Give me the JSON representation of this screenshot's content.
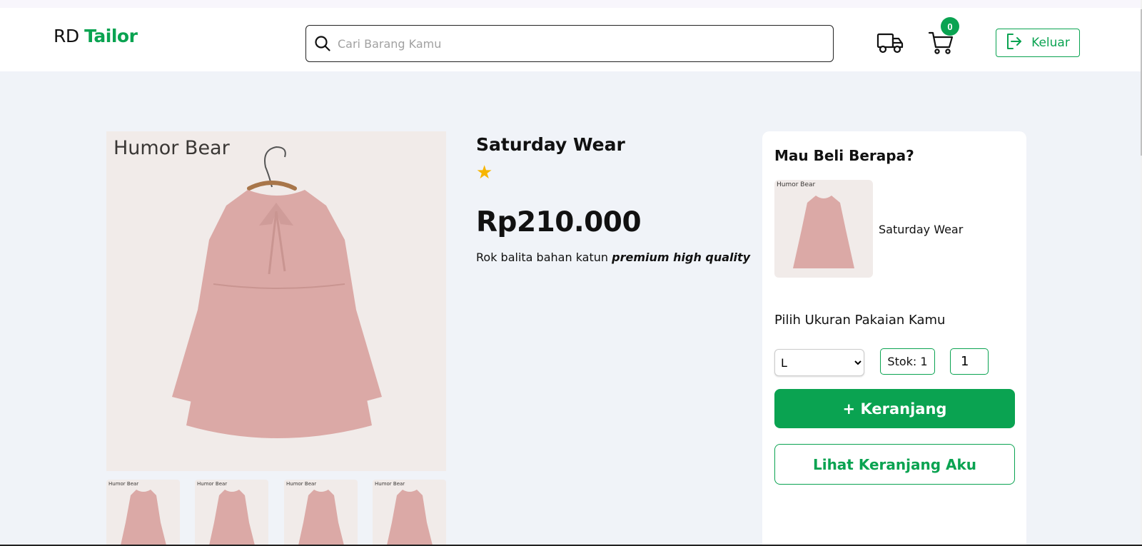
{
  "header": {
    "logo_prefix": "RD",
    "logo_brand": "Tailor",
    "search_placeholder": "Cari Barang Kamu",
    "cart_count": "0",
    "logout_label": "Keluar"
  },
  "product": {
    "image_brand": "Humor Bear",
    "title": "Saturday Wear",
    "stars": "★",
    "rating": 1,
    "price": "Rp210.000",
    "description_plain": "Rok balita bahan katun",
    "description_emphasis": "premium high quality",
    "thumbnail_count": 4
  },
  "purchase": {
    "heading": "Mau Beli Berapa?",
    "product_name": "Saturday Wear",
    "size_heading": "Pilih Ukuran Pakaian Kamu",
    "selected_size": "L",
    "stock_label": "Stok: 1",
    "quantity": "1",
    "add_to_cart_label": "+ Keranjang",
    "view_cart_label": "Lihat Keranjang Aku"
  },
  "colors": {
    "accent": "#0aa351",
    "star": "#f7b500",
    "background": "#f0f3f8",
    "dress": "#dba9a6"
  },
  "icons": {
    "search": "search-icon",
    "truck": "truck-icon",
    "cart": "cart-icon",
    "logout": "logout-icon"
  }
}
